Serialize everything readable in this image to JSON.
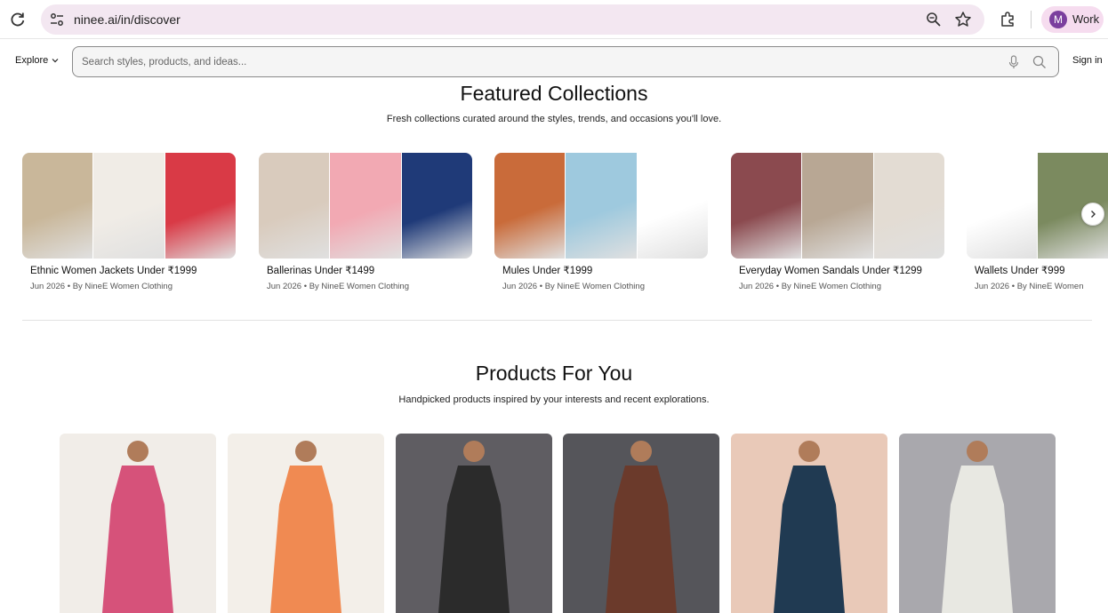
{
  "browser": {
    "url": "ninee.ai/in/discover",
    "profile_initial": "M",
    "profile_label": "Work"
  },
  "header": {
    "explore_label": "Explore",
    "search_placeholder": "Search styles, products, and ideas...",
    "signin_label": "Sign in"
  },
  "featured": {
    "title": "Featured Collections",
    "subtitle": "Fresh collections curated around the styles, trends, and occasions you'll love.",
    "collections": [
      {
        "title": "Ethnic Women Jackets Under ₹1999",
        "meta": "Jun 2026 • By NineE Women Clothing",
        "colors": [
          "#c9b79a",
          "#f0ece6",
          "#d93a46"
        ]
      },
      {
        "title": "Ballerinas Under ₹1499",
        "meta": "Jun 2026 • By NineE Women Clothing",
        "colors": [
          "#d9cbbd",
          "#f2a9b3",
          "#1f3a78"
        ]
      },
      {
        "title": "Mules Under ₹1999",
        "meta": "Jun 2026 • By NineE Women Clothing",
        "colors": [
          "#c96b3a",
          "#9ec9de",
          "#ffffff"
        ]
      },
      {
        "title": "Everyday Women Sandals Under ₹1299",
        "meta": "Jun 2026 • By NineE Women Clothing",
        "colors": [
          "#8b4a4f",
          "#b8a794",
          "#e3dcd3"
        ]
      },
      {
        "title": "Wallets Under ₹999",
        "meta": "Jun 2026 • By NineE Women",
        "colors": [
          "#ffffff",
          "#7b8a5f",
          "#ffffff"
        ]
      }
    ]
  },
  "products": {
    "title": "Products For You",
    "subtitle": "Handpicked products inspired by your interests and recent explorations.",
    "items": [
      {
        "color": "#d6527a",
        "bg": "#f1ede8"
      },
      {
        "color": "#f08a52",
        "bg": "#f3efe9"
      },
      {
        "color": "#2b2b2b",
        "bg": "#5f5d62"
      },
      {
        "color": "#6b3a2b",
        "bg": "#55555a"
      },
      {
        "color": "#203a52",
        "bg": "#e9c9b8"
      },
      {
        "color": "#e8e8e2",
        "bg": "#a9a8ad"
      }
    ]
  }
}
